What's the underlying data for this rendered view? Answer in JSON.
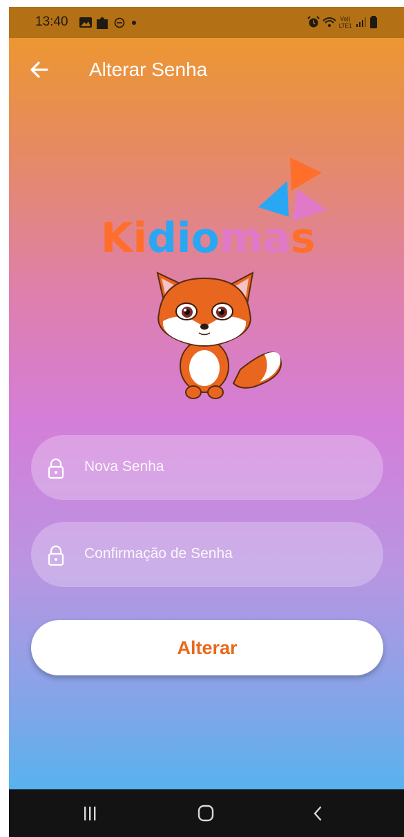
{
  "status_bar": {
    "time": "13:40",
    "icons_left": [
      "gallery-icon",
      "puzzle-icon",
      "do-not-disturb-icon",
      "dot-icon"
    ],
    "icons_right": [
      "alarm-icon",
      "wifi-icon",
      "volte-icon",
      "signal-icon",
      "battery-icon"
    ],
    "network_label": "LTE1"
  },
  "app_bar": {
    "title": "Alterar Senha",
    "back_icon": "arrow-left-icon"
  },
  "logo": {
    "text": "Kidiomas",
    "colors": {
      "orange": "#ff6f2b",
      "blue": "#2aa7f3",
      "pink": "#e07ac8"
    }
  },
  "form": {
    "new_password": {
      "placeholder": "Nova Senha",
      "icon": "lock-icon"
    },
    "confirm_password": {
      "placeholder": "Confirmação de Senha",
      "icon": "lock-icon"
    },
    "submit_label": "Alterar"
  },
  "nav_bar": {
    "icons": [
      "recents-icon",
      "home-icon",
      "back-icon"
    ]
  },
  "colors": {
    "status_bar": "#b47014",
    "accent": "#e8681c",
    "gradient_top": "#ee9a25",
    "gradient_mid": "#d47ed9",
    "gradient_bottom": "#3ebaf2"
  }
}
